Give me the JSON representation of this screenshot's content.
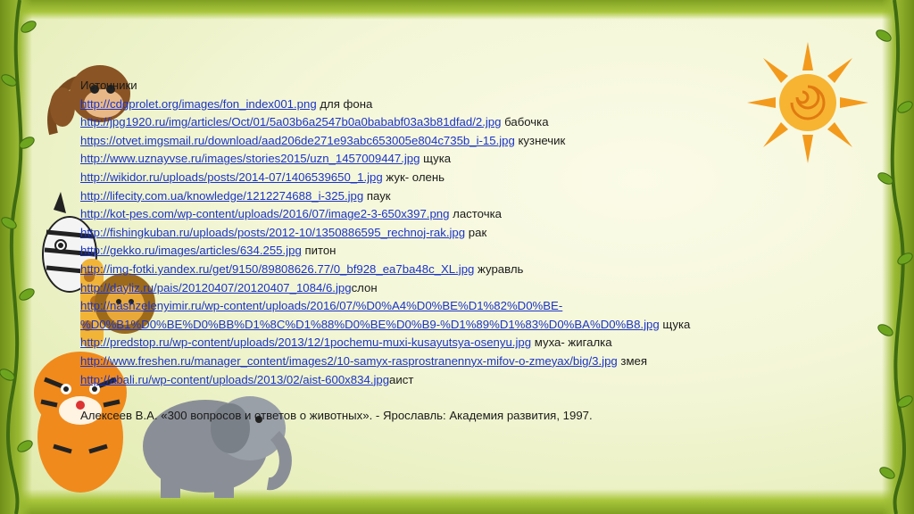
{
  "heading": "Источники",
  "sources": [
    {
      "url": "http://cdgprolet.org/images/fon_index001.png",
      "desc": " для фона"
    },
    {
      "url": "http://jpg1920.ru/img/articles/Oct/01/5a03b6a2547b0a0bababf03a3b81dfad/2.jpg",
      "desc": " бабочка"
    },
    {
      "url": "https://otvet.imgsmail.ru/download/aad206de271e93abc653005e804c735b_i-15.jpg",
      "desc": " кузнечик"
    },
    {
      "url": "http://www.uznayvse.ru/images/stories2015/uzn_1457009447.jpg",
      "desc": " щука"
    },
    {
      "url": "http://wikidor.ru/uploads/posts/2014-07/1406539650_1.jpg",
      "desc": " жук- олень"
    },
    {
      "url": "http://lifecity.com.ua/knowledge/1212274688_i-325.jpg",
      "desc": " паук"
    },
    {
      "url": "http://kot-pes.com/wp-content/uploads/2016/07/image2-3-650x397.png",
      "desc": " ласточка"
    },
    {
      "url": "http://fishingkuban.ru/uploads/posts/2012-10/1350886595_rechnoj-rak.jpg",
      "desc": " рак"
    },
    {
      "url": "http://gekko.ru/images/articles/634.255.jpg",
      "desc": " питон"
    },
    {
      "url": "http://img-fotki.yandex.ru/get/9150/89808626.77/0_bf928_ea7ba48c_XL.jpg",
      "desc": " журавль"
    },
    {
      "url": "http://dayliz.ru/pais/20120407/20120407_1084/6.jpg",
      "desc": "слон"
    },
    {
      "url": "http://nashzelenyimir.ru/wp-content/uploads/2016/07/%D0%A4%D0%BE%D1%82%D0%BE-",
      "desc": ""
    },
    {
      "url": "%D0%B1%D0%BE%D0%BB%D1%8C%D1%88%D0%BE%D0%B9-%D1%89%D1%83%D0%BA%D0%B8.jpg",
      "desc": " щука"
    },
    {
      "url": "http://predstop.ru/wp-content/uploads/2013/12/1pochemu-muxi-kusayutsya-osenyu.jpg",
      "desc": " муха- жигалка"
    },
    {
      "url": "http://www.freshen.ru/manager_content/images2/10-samyx-rasprostranennyx-mifov-o-zmeyax/big/3.jpg",
      "desc": " змея"
    },
    {
      "url": "http://abali.ru/wp-content/uploads/2013/02/aist-600x834.jpg",
      "desc": "аист"
    }
  ],
  "book": "Алексеев В.А. «300 вопросов и ответов о животных». - Ярославль: Академия развития, 1997.",
  "colors": {
    "link": "#1b34c8",
    "frame": "#a9c63c",
    "sun": "#f39a1d"
  },
  "icons": [
    "monkey-icon",
    "zebra-icon",
    "giraffe-icon",
    "lion-icon",
    "tiger-icon",
    "elephant-icon",
    "sun-icon",
    "vine-icon"
  ]
}
